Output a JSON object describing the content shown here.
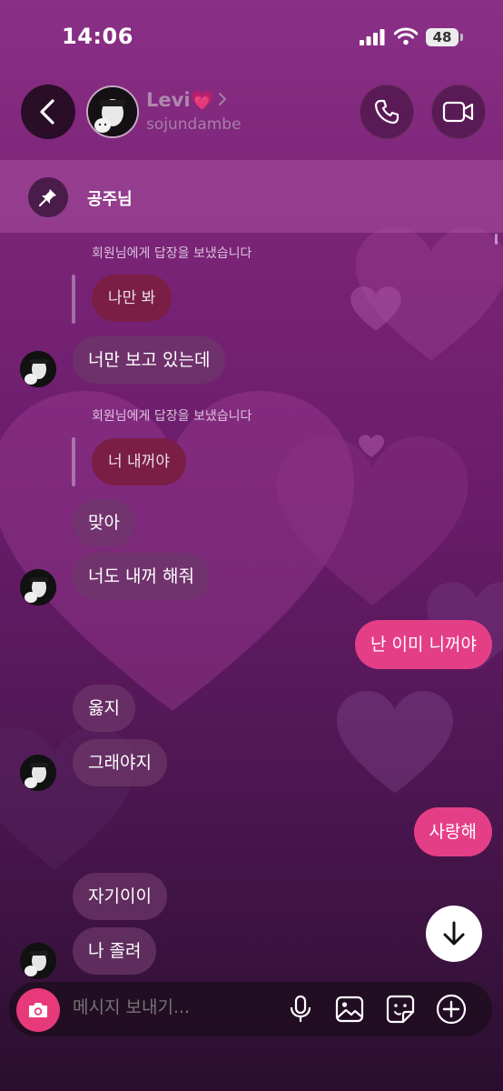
{
  "status_bar": {
    "time": "14:06",
    "battery": "48"
  },
  "header": {
    "name": "Levi💗",
    "handle": "sojundambe"
  },
  "pinned": {
    "text": "공주님"
  },
  "messages": {
    "reply_note_1": "회원님에게 답장을 보냈습니다",
    "quoted_1": "나만 봐",
    "msg_1": "너만 보고 있는데",
    "reply_note_2": "회원님에게 답장을 보냈습니다",
    "quoted_2": "너 내꺼야",
    "msg_2": "맞아",
    "msg_3": "너도 내꺼 해줘",
    "sent_1": "난 이미 니꺼야",
    "msg_4": "옳지",
    "msg_5": "그래야지",
    "sent_2": "사랑해",
    "msg_6": "자기이이",
    "msg_7": "나 졸려"
  },
  "composer": {
    "placeholder": "메시지 보내기..."
  },
  "colors": {
    "accent": "#e43f86",
    "incoming": "#6e3769",
    "quoted": "#7a1e46"
  },
  "icons": [
    "back-icon",
    "chevron-right-icon",
    "phone-icon",
    "video-icon",
    "pin-icon",
    "arrow-down-icon",
    "camera-icon",
    "mic-icon",
    "image-icon",
    "sticker-icon",
    "plus-icon"
  ]
}
